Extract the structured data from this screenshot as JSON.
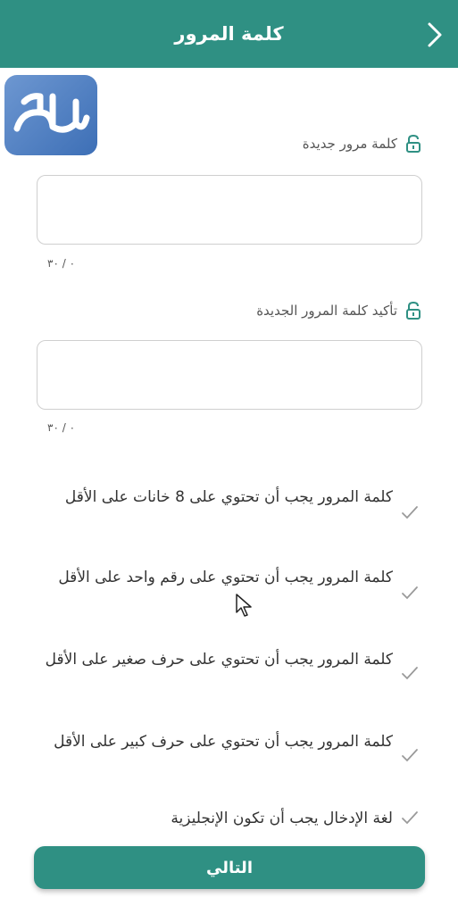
{
  "header": {
    "title": "كلمة المرور"
  },
  "logo": {
    "text": "المرجع"
  },
  "new_password": {
    "label": "كلمة مرور جديدة",
    "value": "",
    "counter": "٠ / ٣٠"
  },
  "confirm_password": {
    "label": "تأكيد كلمة المرور الجديدة",
    "value": "",
    "counter": "٠ / ٣٠"
  },
  "rules": [
    {
      "text": "كلمة المرور يجب أن تحتوي على 8 خانات على الأقل"
    },
    {
      "text": "كلمة المرور يجب أن تحتوي على رقم واحد على الأقل"
    },
    {
      "text": "كلمة المرور يجب أن تحتوي على حرف صغير على الأقل"
    },
    {
      "text": "كلمة المرور يجب أن تحتوي على حرف كبير على الأقل"
    },
    {
      "text": "لغة الإدخال يجب أن تكون الإنجليزية"
    }
  ],
  "next_button": {
    "label": "التالي"
  },
  "colors": {
    "primary": "#2f9083",
    "check": "#9a9a9a"
  }
}
